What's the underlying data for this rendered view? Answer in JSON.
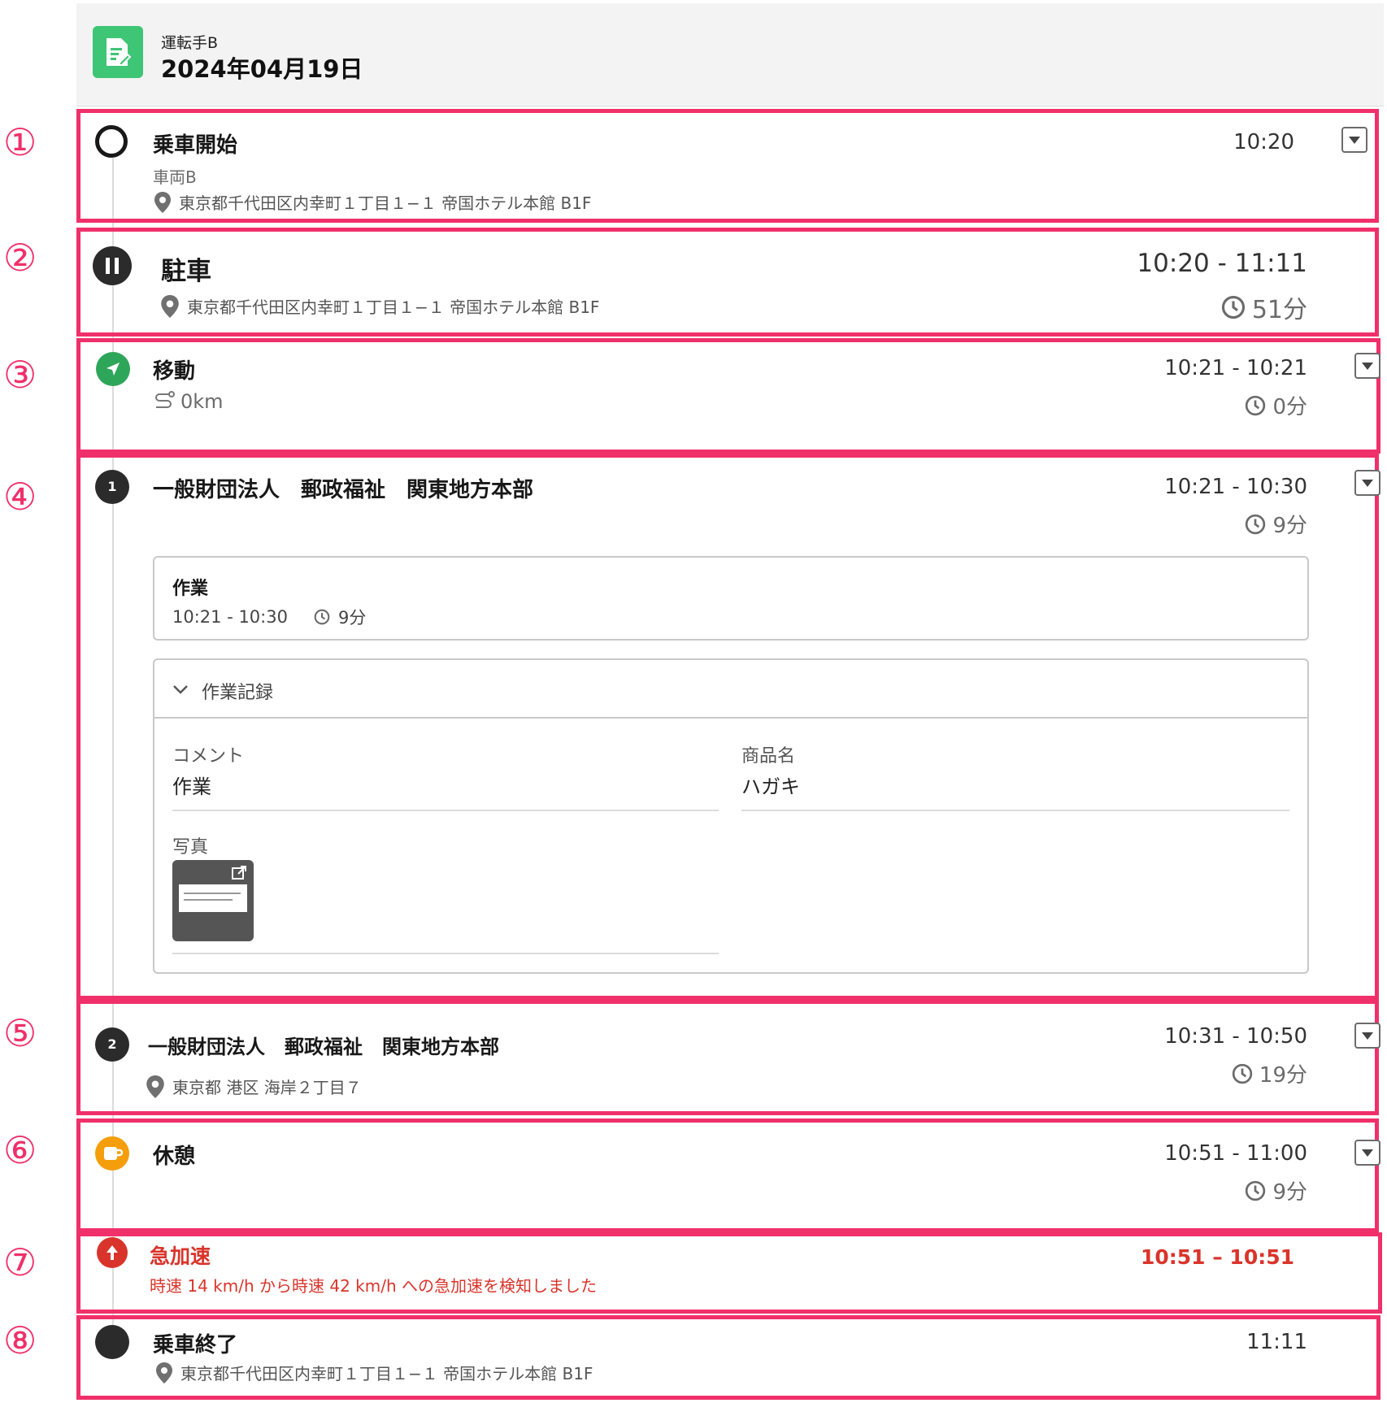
{
  "header": {
    "subtitle": "運転手B",
    "title": "2024年04月19日",
    "icon": "report-document-icon"
  },
  "markers": [
    "①",
    "②",
    "③",
    "④",
    "⑤",
    "⑥",
    "⑦",
    "⑧"
  ],
  "events": {
    "start": {
      "title": "乗車開始",
      "vehicle": "車両B",
      "address": "東京都千代田区内幸町１丁目１−１ 帝国ホテル本館 B1F",
      "time": "10:20"
    },
    "parking": {
      "title": "駐車",
      "address": "東京都千代田区内幸町１丁目１−１ 帝国ホテル本館 B1F",
      "time": "10:20 - 11:11",
      "duration": "51分"
    },
    "move": {
      "title": "移動",
      "distance": "0km",
      "time": "10:21 - 10:21",
      "duration": "0分"
    },
    "visit1": {
      "number": "1",
      "title": "一般財団法人　郵政福祉　関東地方本部",
      "time": "10:21 - 10:30",
      "duration": "9分",
      "task": {
        "title": "作業",
        "time": "10:21 - 10:30",
        "duration": "9分"
      },
      "record": {
        "header": "作業記録",
        "comment_label": "コメント",
        "comment_value": "作業",
        "product_label": "商品名",
        "product_value": "ハガキ",
        "photo_label": "写真"
      }
    },
    "visit2": {
      "number": "2",
      "title": "一般財団法人　郵政福祉　関東地方本部",
      "address": "東京都 港区 海岸２丁目７",
      "time": "10:31 - 10:50",
      "duration": "19分"
    },
    "rest": {
      "title": "休憩",
      "time": "10:51 - 11:00",
      "duration": "9分"
    },
    "accel": {
      "title": "急加速",
      "message": "時速 14 km/h から時速 42 km/h への急加速を検知しました",
      "time": "10:51 – 10:51"
    },
    "end": {
      "title": "乗車終了",
      "address": "東京都千代田区内幸町１丁目１−１ 帝国ホテル本館 B1F",
      "time": "11:11"
    }
  },
  "colors": {
    "highlight": "#f0306a",
    "move": "#2ea65a",
    "rest": "#f59e0b",
    "alert": "#d9342b",
    "app": "#3ec575"
  }
}
